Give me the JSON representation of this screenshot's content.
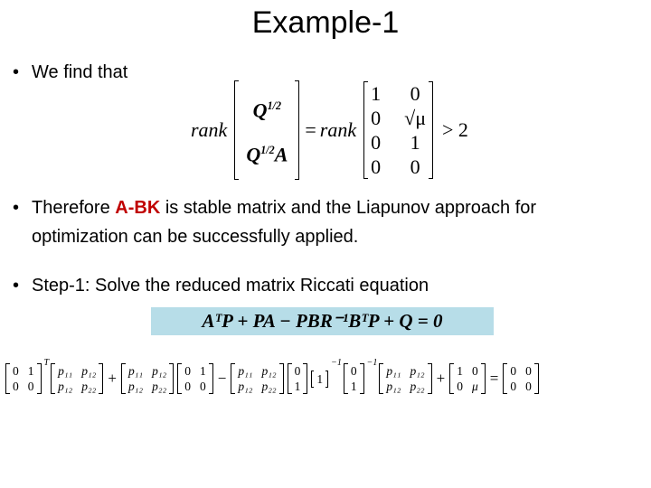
{
  "title": "Example-1",
  "bullets": {
    "marker": "•",
    "b1": "We find that",
    "b2": {
      "pre": "Therefore ",
      "highlight": "A-BK",
      "post": " is stable matrix and the Liapunov approach for",
      "line2": "optimization can be successfully applied."
    },
    "b3": "Step-1: Solve the reduced matrix Riccati equation"
  },
  "colors": {
    "highlight_text": "#c00000",
    "equation_box": "#b7dde8"
  },
  "rank_equation": {
    "rank_label": "rank",
    "left_col": [
      "Q",
      "Q"
    ],
    "left_sup": "1/2",
    "left_suffix": "A",
    "equals": "=",
    "right_matrix": [
      [
        "1",
        "0"
      ],
      [
        "0",
        "√μ"
      ],
      [
        "0",
        "1"
      ],
      [
        "0",
        "0"
      ]
    ],
    "relation": "> 2"
  },
  "riccati_equation": "AᵀP + PA − PBR⁻¹BᵀP + Q = 0",
  "expanded_equation": [
    {
      "m": [
        [
          "0",
          "1"
        ],
        [
          "0",
          "0"
        ]
      ],
      "sup": "T"
    },
    {
      "m": [
        [
          "p₁₁",
          "p₁₂"
        ],
        [
          "p₁₂",
          "p₂₂"
        ]
      ]
    },
    {
      "op": "+"
    },
    {
      "m": [
        [
          "p₁₁",
          "p₁₂"
        ],
        [
          "p₁₂",
          "p₂₂"
        ]
      ]
    },
    {
      "m": [
        [
          "0",
          "1"
        ],
        [
          "0",
          "0"
        ]
      ]
    },
    {
      "op": "−"
    },
    {
      "m": [
        [
          "p₁₁",
          "p₁₂"
        ],
        [
          "p₁₂",
          "p₂₂"
        ]
      ]
    },
    {
      "m": [
        [
          "0"
        ],
        [
          "1"
        ]
      ]
    },
    {
      "m": [
        [
          "1"
        ]
      ],
      "sup": "−1",
      "single": true
    },
    {
      "m": [
        [
          "0"
        ],
        [
          "1"
        ]
      ],
      "sup": "−1"
    },
    {
      "m": [
        [
          "p₁₁",
          "p₁₂"
        ],
        [
          "p₁₂",
          "p₂₂"
        ]
      ]
    },
    {
      "op": "+"
    },
    {
      "m": [
        [
          "1",
          "0"
        ],
        [
          "0",
          "μ"
        ]
      ]
    },
    {
      "op": "="
    },
    {
      "m": [
        [
          "0",
          "0"
        ],
        [
          "0",
          "0"
        ]
      ]
    }
  ]
}
